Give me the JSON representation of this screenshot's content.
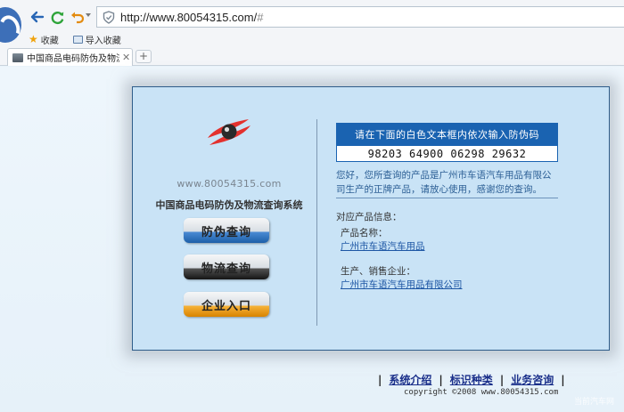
{
  "browser": {
    "url": "http://www.80054315.com/",
    "url_hash": "#",
    "bookmarks": [
      "收藏",
      "导入收藏"
    ],
    "tab_title": "中国商品电码防伪及物流",
    "new_tab_symbol": "+",
    "close_symbol": "✕"
  },
  "brand": {
    "url_text": "www.80054315.com",
    "system_name": "中国商品电码防伪及物流查询系统"
  },
  "menu": {
    "anti_fake": "防伪查询",
    "logistics": "物流查询",
    "enterprise": "企业入口"
  },
  "query": {
    "hint": "请在下面的白色文本框内依次输入防伪码",
    "code": "98203 64900 06298 29632",
    "result": "您好，您所查询的产品是广州市车语汽车用品有限公司生产的正牌产品，请放心使用，感谢您的查询。"
  },
  "product_info": {
    "title": "对应产品信息：",
    "name_label": "产品名称：",
    "name_value": "广州市车语汽车用品",
    "maker_label": "生产、销售企业：",
    "maker_value": "广州市车语汽车用品有限公司"
  },
  "footer": {
    "separator": "|",
    "links": [
      "系统介绍",
      "标识种类",
      "业务咨询"
    ],
    "copyright": "copyright ©2008 www.80054315.com"
  },
  "watermark": "当前汽车网",
  "colors": {
    "panel_bg": "#c9e3f6",
    "hint_bg": "#1a63b1",
    "brand_red": "#e3312e",
    "link": "#1d56a4"
  },
  "icons": [
    "browser-logo-icon",
    "back-arrow-icon",
    "refresh-icon",
    "undo-icon",
    "shield-icon",
    "star-icon",
    "folder-icon",
    "brand-eye-logo-icon"
  ]
}
